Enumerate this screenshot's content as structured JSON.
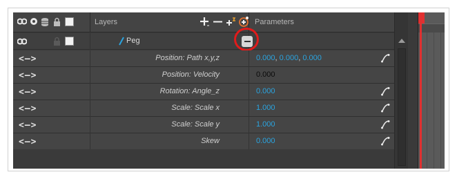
{
  "header": {
    "layers_label": "Layers",
    "parameters_label": "Parameters"
  },
  "peg": {
    "name": "Peg"
  },
  "rows": [
    {
      "label": "Position: Path x,y,z",
      "values": [
        "0.000",
        "0.000",
        "0.000"
      ]
    },
    {
      "label": "Position: Velocity",
      "value": "0.000"
    },
    {
      "label": "Rotation: Angle_z",
      "value": "0.000"
    },
    {
      "label": "Scale: Scale x",
      "value": "1.000"
    },
    {
      "label": "Scale: Scale y",
      "value": "1.000"
    },
    {
      "label": "Skew",
      "value": "0.000"
    }
  ],
  "arrows_glyph": "<—>",
  "value_separator": ",",
  "colors": {
    "panel_bg": "#3c3c3c",
    "value_blue": "#2aa4e0",
    "highlight_red": "#e01b1b",
    "playhead_red": "#e03030"
  }
}
